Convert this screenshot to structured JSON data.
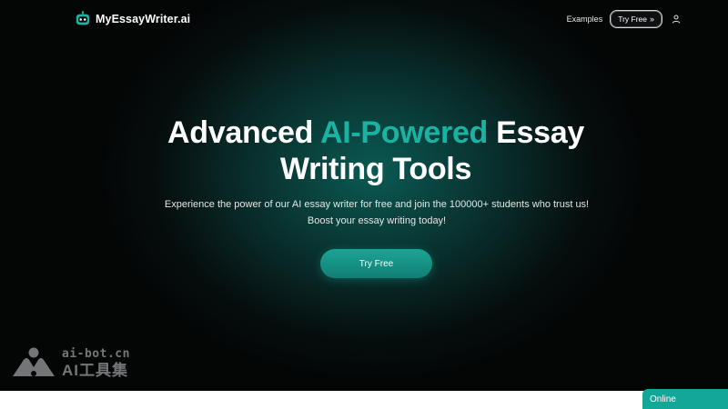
{
  "brand": {
    "name": "MyEssayWriter.ai",
    "icon": "robot-head-icon",
    "accent_color": "#19b3a3"
  },
  "nav": {
    "examples_label": "Examples",
    "try_free_label": "Try Free",
    "try_free_icon": "double-chevron-right-icon",
    "account_icon": "user-icon"
  },
  "hero": {
    "title_part1": "Advanced ",
    "title_accent": "AI-Powered",
    "title_part2": " Essay",
    "title_line2": "Writing Tools",
    "subtitle_line1": "Experience the power of our AI essay writer for free and join the 100000+ students who trust us!",
    "subtitle_line2": "Boost your essay writing today!",
    "cta_label": "Try Free"
  },
  "watermark": {
    "line1": "ai-bot.cn",
    "line2": "AI工具集"
  },
  "chat": {
    "status_label": "Online",
    "color": "#12a797"
  }
}
